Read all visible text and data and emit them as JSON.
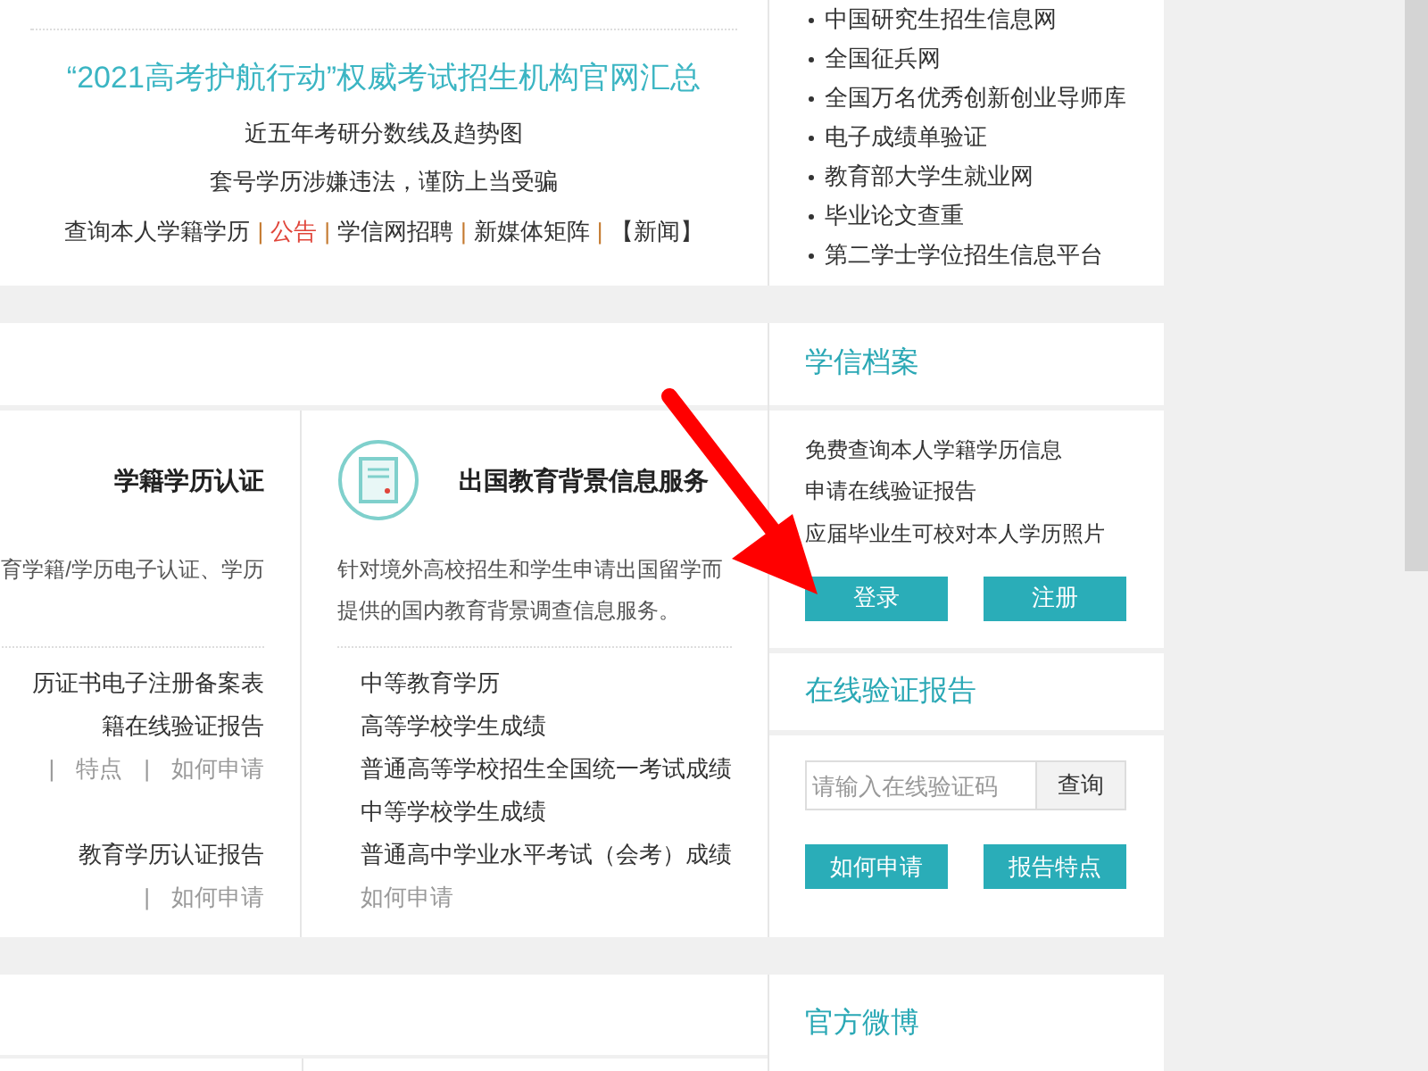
{
  "separator": "|",
  "top_notice": {
    "headline": "“2021高考护航行动”权威考试招生机构官网汇总",
    "links": [
      "近五年考研分数线及趋势图",
      "套号学历涉嫌违法，谨防上当受骗"
    ],
    "nav": [
      {
        "label": "查询本人学籍学历",
        "kind": "normal"
      },
      {
        "label": "公告",
        "kind": "alert"
      },
      {
        "label": "学信网招聘",
        "kind": "normal"
      },
      {
        "label": "新媒体矩阵",
        "kind": "normal"
      },
      {
        "label": "【新闻】",
        "kind": "normal"
      }
    ]
  },
  "related_sites": [
    "中国研究生招生信息网",
    "全国征兵网",
    "全国万名优秀创新创业导师库",
    "电子成绩单验证",
    "教育部大学生就业网",
    "毕业论文查重",
    "第二学士学位招生信息平台"
  ],
  "services": [
    {
      "title": "学籍学历认证",
      "has_icon": false,
      "description": "育学籍/学历电子认证、学历",
      "items": [
        {
          "kind": "item",
          "labels": [
            "历证书电子注册备案表"
          ]
        },
        {
          "kind": "item",
          "labels": [
            "籍在线验证报告"
          ]
        },
        {
          "kind": "actions",
          "labels": [
            "特点",
            "如何申请"
          ]
        },
        {
          "kind": "gap"
        },
        {
          "kind": "item",
          "labels": [
            "教育学历认证报告"
          ]
        },
        {
          "kind": "actions",
          "labels": [
            "如何申请"
          ]
        }
      ]
    },
    {
      "title": "出国教育背景信息服务",
      "has_icon": true,
      "description": "针对境外高校招生和学生申请出国留学而提供的国内教育背景调查信息服务。",
      "items": [
        {
          "kind": "item",
          "labels": [
            "中等教育学历"
          ]
        },
        {
          "kind": "item",
          "labels": [
            "高等学校学生成绩"
          ]
        },
        {
          "kind": "item",
          "labels": [
            "普通高等学校招生全国统一考试成绩"
          ]
        },
        {
          "kind": "item",
          "labels": [
            "中等学校学生成绩"
          ]
        },
        {
          "kind": "item",
          "labels": [
            "普通高中学业水平考试（会考）成绩"
          ]
        },
        {
          "kind": "muted",
          "labels": [
            "如何申请"
          ]
        }
      ]
    }
  ],
  "archive": {
    "title": "学信档案",
    "lines": [
      "免费查询本人学籍学历信息",
      "申请在线验证报告",
      "应届毕业生可校对本人学历照片"
    ],
    "buttons": [
      "登录",
      "注册"
    ]
  },
  "verify": {
    "title": "在线验证报告",
    "input": {
      "placeholder": "请输入在线验证码"
    },
    "search_button": "查询",
    "buttons": [
      "如何申请",
      "报告特点"
    ]
  },
  "weibo": {
    "title": "官方微博"
  }
}
